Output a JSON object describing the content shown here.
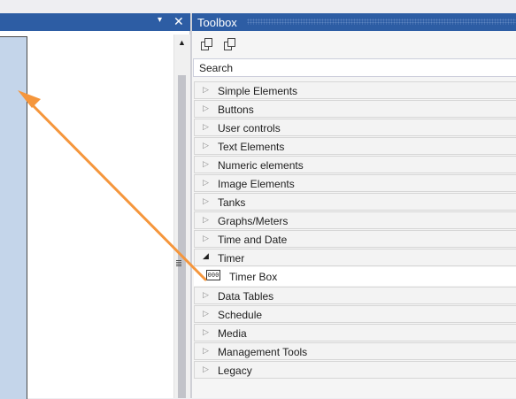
{
  "left_pane": {
    "pin_glyph": "▾",
    "close_glyph": "✕",
    "scroll_up_glyph": "▲"
  },
  "toolbox": {
    "title": "Toolbox",
    "search_placeholder": "Search",
    "groups": [
      {
        "label": "Simple Elements",
        "expanded": false
      },
      {
        "label": "Buttons",
        "expanded": false
      },
      {
        "label": "User controls",
        "expanded": false
      },
      {
        "label": "Text Elements",
        "expanded": false
      },
      {
        "label": "Numeric elements",
        "expanded": false
      },
      {
        "label": "Image Elements",
        "expanded": false
      },
      {
        "label": "Tanks",
        "expanded": false
      },
      {
        "label": "Graphs/Meters",
        "expanded": false
      },
      {
        "label": "Time and Date",
        "expanded": false
      },
      {
        "label": "Timer",
        "expanded": true,
        "items": [
          {
            "label": "Timer Box",
            "icon": "timer-box-icon",
            "icon_text": "000"
          }
        ]
      },
      {
        "label": "Data Tables",
        "expanded": false
      },
      {
        "label": "Schedule",
        "expanded": false
      },
      {
        "label": "Media",
        "expanded": false
      },
      {
        "label": "Management Tools",
        "expanded": false
      },
      {
        "label": "Legacy",
        "expanded": false
      }
    ]
  },
  "colors": {
    "header_blue": "#2d5da4",
    "canvas_blue": "#c4d5ea",
    "arrow_orange": "#f5963c"
  },
  "glyphs": {
    "collapsed": "▷",
    "expanded": "◢"
  }
}
